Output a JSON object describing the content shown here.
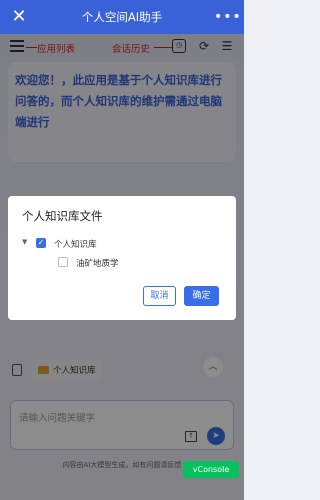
{
  "app": {
    "title": "个人空间AI助手",
    "close_icon": "close-icon",
    "more_icon": "more-icon"
  },
  "toolbar": {
    "app_list_annotation": "应用列表",
    "history_annotation": "会话历史",
    "menu_icon": "menu-icon",
    "history_icon": "history-icon",
    "new_chat_icon": "new-chat-icon",
    "user_settings_icon": "user-settings-icon"
  },
  "welcome": {
    "text": "欢迎您！，此应用是基于个人知识库进行问答的，而个人知识库的维护需通过电脑端进行"
  },
  "dialog": {
    "title": "个人知识库文件",
    "tree": [
      {
        "label": "个人知识库",
        "checked": true,
        "expanded": true
      },
      {
        "label": "油矿地质学",
        "checked": false
      }
    ],
    "cancel_label": "取消",
    "confirm_label": "确定"
  },
  "knowledge_chip": {
    "label": "个人知识库"
  },
  "input": {
    "placeholder": "请输入问题关键字"
  },
  "footer": {
    "text": "内容由AI大模型生成，如有问题请反馈",
    "vconsole_label": "vConsole"
  },
  "colors": {
    "primary": "#3a6ee8",
    "header": "#3a62d8",
    "annotation": "#e02020"
  }
}
